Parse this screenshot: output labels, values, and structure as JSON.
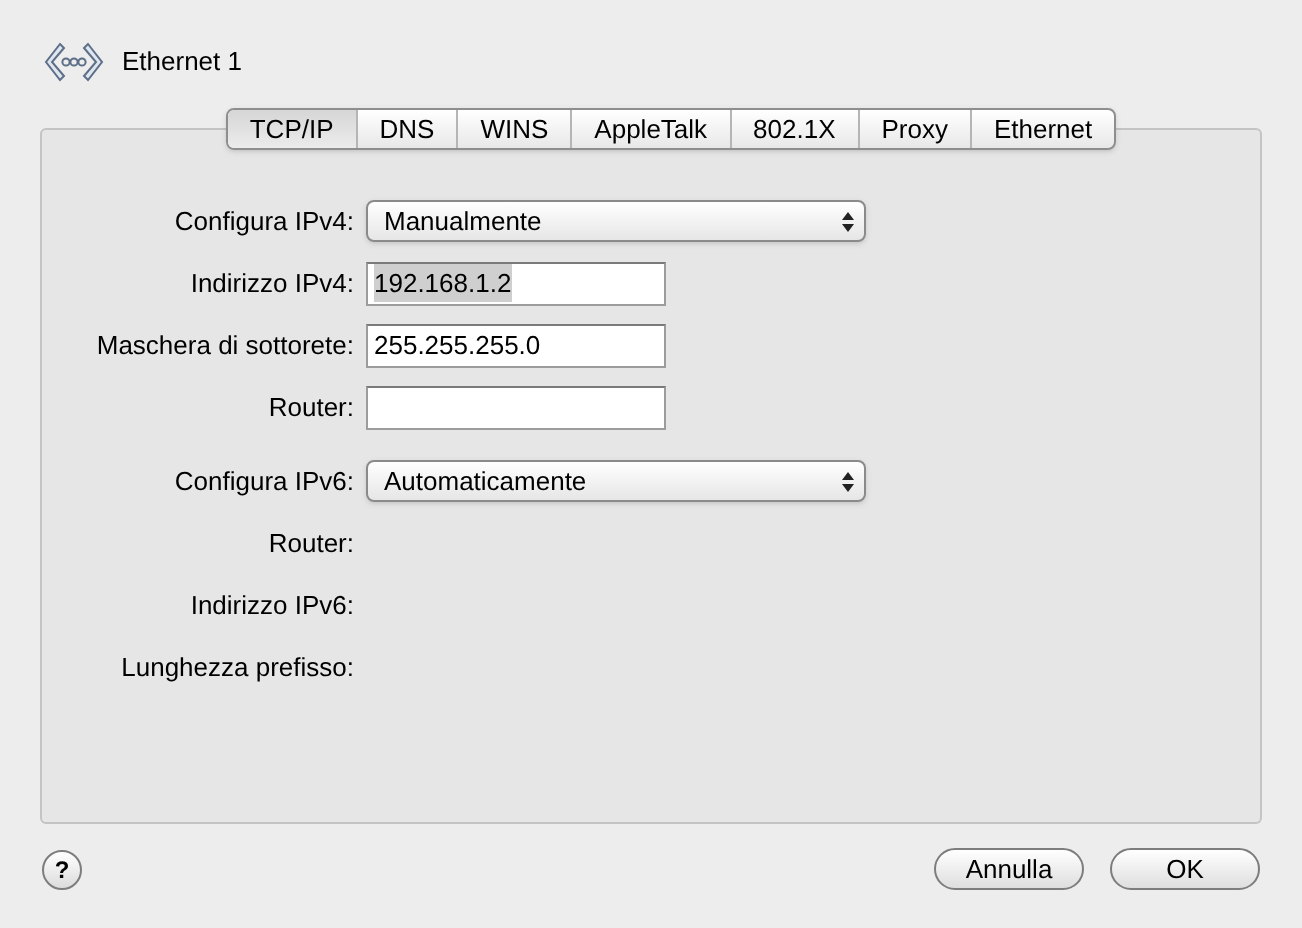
{
  "window": {
    "title": "Ethernet 1"
  },
  "tabs": [
    {
      "label": "TCP/IP",
      "selected": true
    },
    {
      "label": "DNS",
      "selected": false
    },
    {
      "label": "WINS",
      "selected": false
    },
    {
      "label": "AppleTalk",
      "selected": false
    },
    {
      "label": "802.1X",
      "selected": false
    },
    {
      "label": "Proxy",
      "selected": false
    },
    {
      "label": "Ethernet",
      "selected": false
    }
  ],
  "fields": [
    {
      "kind": "popup",
      "label": "Configura IPv4:",
      "value": "Manualmente"
    },
    {
      "kind": "text",
      "label": "Indirizzo IPv4:",
      "value": "192.168.1.2",
      "highlighted": true
    },
    {
      "kind": "text",
      "label": "Maschera di sottorete:",
      "value": "255.255.255.0"
    },
    {
      "kind": "text",
      "label": "Router:"
    },
    {
      "kind": "popup",
      "label": "Configura IPv6:",
      "value": "Automaticamente"
    },
    {
      "kind": "static",
      "label": "Router:"
    },
    {
      "kind": "static",
      "label": "Indirizzo IPv6:"
    },
    {
      "kind": "static",
      "label": "Lunghezza prefisso:"
    }
  ],
  "help_button": {
    "label": "?"
  },
  "buttons": [
    "Annulla",
    "OK"
  ]
}
